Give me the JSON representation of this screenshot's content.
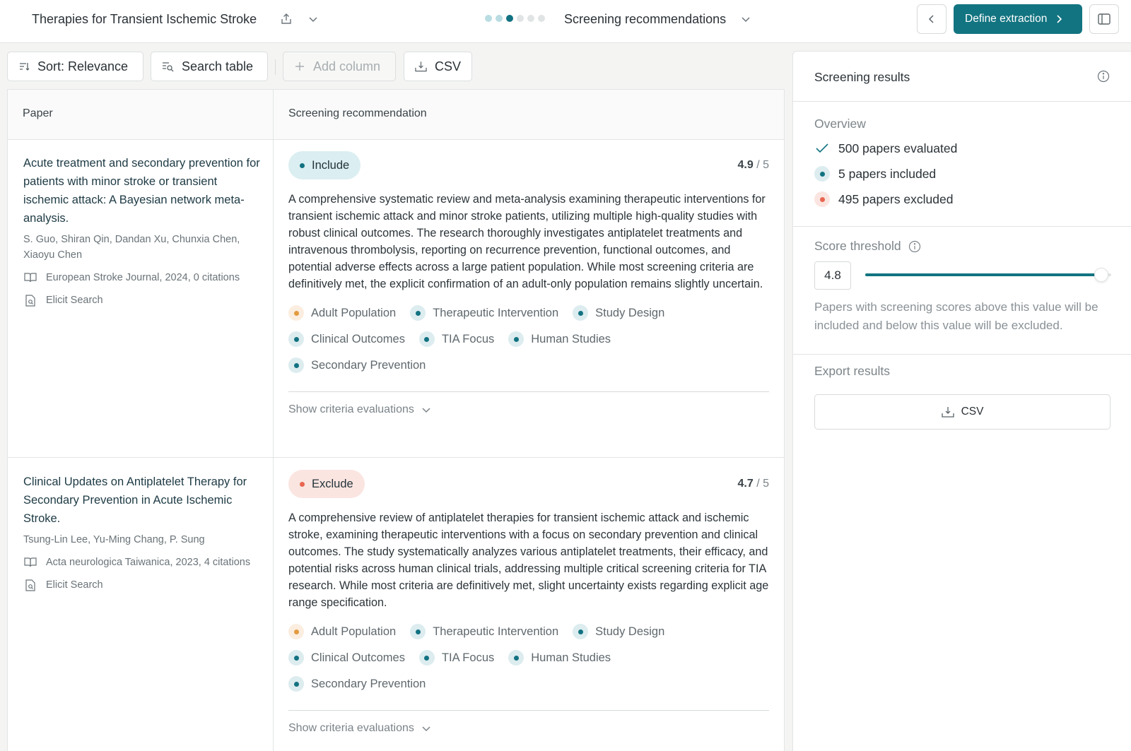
{
  "header": {
    "project_title": "Therapies for Transient Ischemic Stroke",
    "step_title": "Screening recommendations",
    "define_extraction_label": "Define extraction",
    "progress": {
      "total_steps": 6,
      "current_step": 3
    }
  },
  "toolbar": {
    "sort_label": "Sort: Relevance",
    "search_label": "Search table",
    "add_column_label": "Add column",
    "csv_label": "CSV"
  },
  "table": {
    "columns": [
      "Paper",
      "Screening recommendation"
    ],
    "rows": [
      {
        "title": "Acute treatment and secondary prevention for patients with minor stroke or transient ischemic attack: A Bayesian network meta-analysis.",
        "authors": "S. Guo, Shiran Qin, Dandan Xu, Chunxia Chen, Xiaoyu Chen",
        "journal": "European Stroke Journal, 2024, 0 citations",
        "source": "Elicit Search",
        "decision": "Include",
        "score": "4.9",
        "score_max": "/ 5",
        "summary": "A comprehensive systematic review and meta-analysis examining therapeutic interventions for transient ischemic attack and minor stroke patients, utilizing multiple high-quality studies with robust clinical outcomes. The research thoroughly investigates antiplatelet treatments and intravenous thrombolysis, reporting on recurrence prevention, functional outcomes, and potential adverse effects across a large patient population. While most screening criteria are definitively met, the explicit confirmation of an adult-only population remains slightly uncertain.",
        "criteria": [
          {
            "label": "Adult Population",
            "status": "maybe"
          },
          {
            "label": "Therapeutic Intervention",
            "status": "yes"
          },
          {
            "label": "Study Design",
            "status": "yes"
          },
          {
            "label": "Clinical Outcomes",
            "status": "yes"
          },
          {
            "label": "TIA Focus",
            "status": "yes"
          },
          {
            "label": "Human Studies",
            "status": "yes"
          },
          {
            "label": "Secondary Prevention",
            "status": "yes"
          }
        ],
        "show_criteria_label": "Show criteria evaluations"
      },
      {
        "title": "Clinical Updates on Antiplatelet Therapy for Secondary Prevention in Acute Ischemic Stroke.",
        "authors": "Tsung-Lin Lee, Yu-Ming Chang, P. Sung",
        "journal": "Acta neurologica Taiwanica, 2023, 4 citations",
        "source": "Elicit Search",
        "decision": "Exclude",
        "score": "4.7",
        "score_max": "/ 5",
        "summary": "A comprehensive review of antiplatelet therapies for transient ischemic attack and ischemic stroke, examining therapeutic interventions with a focus on secondary prevention and clinical outcomes. The study systematically analyzes various antiplatelet treatments, their efficacy, and potential risks across human clinical trials, addressing multiple critical screening criteria for TIA research. While most criteria are definitively met, slight uncertainty exists regarding explicit age range specification.",
        "criteria": [
          {
            "label": "Adult Population",
            "status": "maybe"
          },
          {
            "label": "Therapeutic Intervention",
            "status": "yes"
          },
          {
            "label": "Study Design",
            "status": "yes"
          },
          {
            "label": "Clinical Outcomes",
            "status": "yes"
          },
          {
            "label": "TIA Focus",
            "status": "yes"
          },
          {
            "label": "Human Studies",
            "status": "yes"
          },
          {
            "label": "Secondary Prevention",
            "status": "yes"
          }
        ],
        "show_criteria_label": "Show criteria evaluations"
      }
    ]
  },
  "panel": {
    "title": "Screening results",
    "overview_label": "Overview",
    "evaluated": "500 papers evaluated",
    "included": "5 papers included",
    "excluded": "495 papers excluded",
    "threshold_label": "Score threshold",
    "threshold_value": "4.8",
    "threshold_min": 0,
    "threshold_max": 5,
    "threshold_help": "Papers with screening scores above this value will be included and below this value will be excluded.",
    "export_label": "Export results",
    "csv_label": "CSV"
  },
  "colors": {
    "accent": "#137481",
    "include": "#127281",
    "exclude": "#e8664f",
    "maybe": "#e39a3f"
  }
}
